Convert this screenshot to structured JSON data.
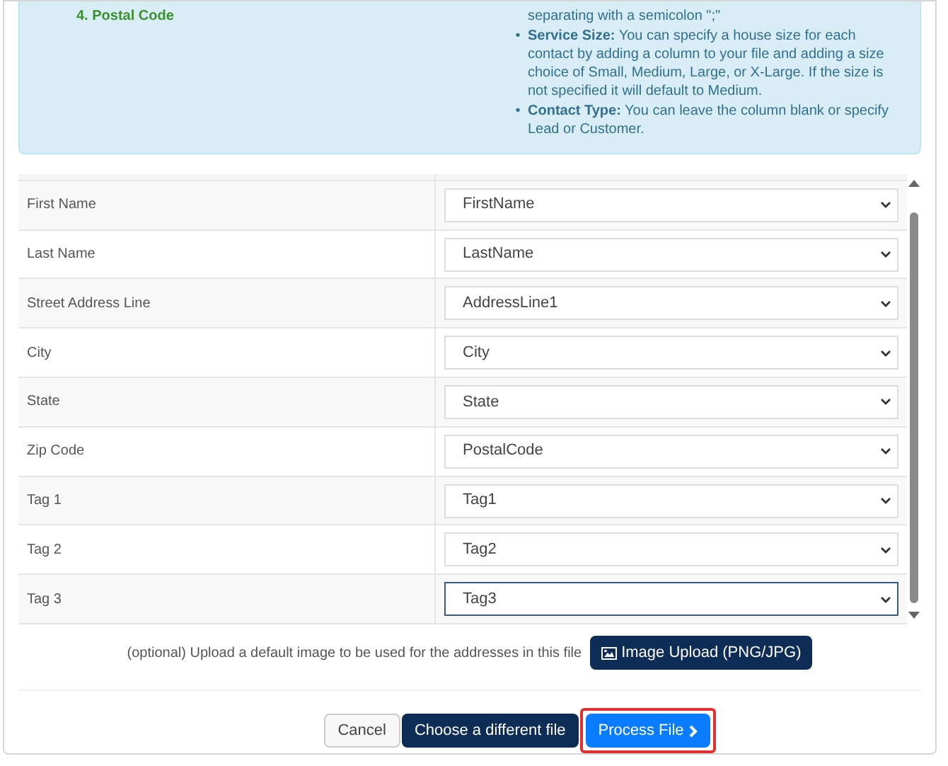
{
  "info_panel": {
    "steps_visible": [
      {
        "text": "4. Postal Code"
      }
    ],
    "notes": [
      {
        "kind": "continuation",
        "text": "separating with a semicolon \";\""
      },
      {
        "kind": "bullet",
        "marker": "•",
        "text": "**Service Size:** You can specify a house size for each contact by adding a column to your file and adding a size choice of Small, Medium, Large, or X-Large. If the size is not specified it will default to Medium."
      },
      {
        "kind": "bullet",
        "marker": "•",
        "text": "**Contact Type:** You can leave the column blank or specify Lead or Customer."
      }
    ]
  },
  "mapping_table": {
    "rows": [
      {
        "field": "First Name",
        "value": "FirstName",
        "focused": false
      },
      {
        "field": "Last Name",
        "value": "LastName",
        "focused": false
      },
      {
        "field": "Street Address Line",
        "value": "AddressLine1",
        "focused": false
      },
      {
        "field": "City",
        "value": "City",
        "focused": false
      },
      {
        "field": "State",
        "value": "State",
        "focused": false
      },
      {
        "field": "Zip Code",
        "value": "PostalCode",
        "focused": false
      },
      {
        "field": "Tag 1",
        "value": "Tag1",
        "focused": false
      },
      {
        "field": "Tag 2",
        "value": "Tag2",
        "focused": false
      },
      {
        "field": "Tag 3",
        "value": "Tag3",
        "focused": true
      }
    ]
  },
  "image_upload": {
    "hint": "(optional) Upload a default image to be used for the addresses in this file",
    "button": "Image Upload (PNG/JPG)"
  },
  "buttons": [
    {
      "kind": "secondary",
      "label": "Cancel",
      "highlighted": false
    },
    {
      "kind": "dark",
      "label": "Choose a different file",
      "highlighted": false
    },
    {
      "kind": "primary",
      "label": "Process File",
      "highlighted": true
    }
  ]
}
